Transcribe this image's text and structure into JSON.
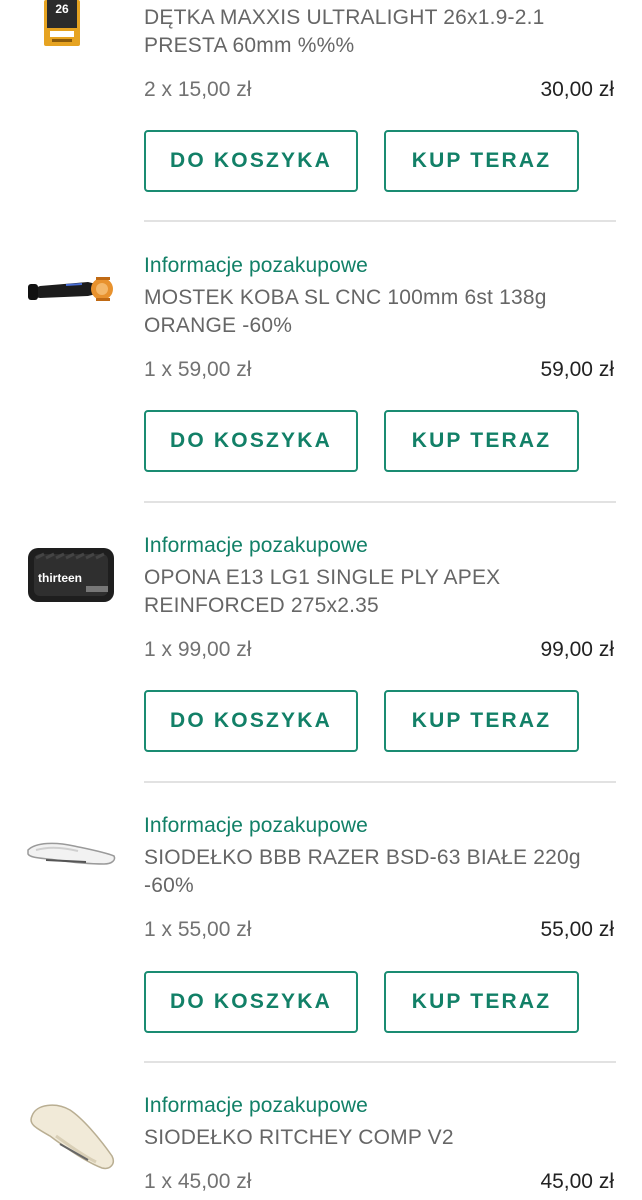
{
  "items": [
    {
      "after_purchase_link": "",
      "title": "DĘTKA MAXXIS ULTRALIGHT 26x1.9-2.1 PRESTA 60mm %%%",
      "qty_price": "2 x 15,00 zł",
      "total": "30,00 zł",
      "image_icon": "inner-tube-package-icon",
      "add_to_cart_label": "DO KOSZYKA",
      "buy_now_label": "KUP TERAZ"
    },
    {
      "after_purchase_link": "Informacje pozakupowe",
      "title": "MOSTEK KOBA SL CNC 100mm 6st 138g ORANGE -60%",
      "qty_price": "1 x 59,00 zł",
      "total": "59,00 zł",
      "image_icon": "bike-stem-icon",
      "add_to_cart_label": "DO KOSZYKA",
      "buy_now_label": "KUP TERAZ"
    },
    {
      "after_purchase_link": "Informacje pozakupowe",
      "title": "OPONA E13 LG1 SINGLE PLY APEX REINFORCED 275x2.35",
      "qty_price": "1 x 99,00 zł",
      "total": "99,00 zł",
      "image_icon": "tire-icon",
      "add_to_cart_label": "DO KOSZYKA",
      "buy_now_label": "KUP TERAZ"
    },
    {
      "after_purchase_link": "Informacje pozakupowe",
      "title": "SIODEŁKO BBB RAZER BSD-63 BIAŁE 220g -60%",
      "qty_price": "1 x 55,00 zł",
      "total": "55,00 zł",
      "image_icon": "white-saddle-icon",
      "add_to_cart_label": "DO KOSZYKA",
      "buy_now_label": "KUP TERAZ"
    },
    {
      "after_purchase_link": "Informacje pozakupowe",
      "title": "SIODEŁKO RITCHEY COMP V2",
      "qty_price": "1 x 45,00 zł",
      "total": "45,00 zł",
      "image_icon": "cream-saddle-icon"
    }
  ],
  "colors": {
    "accent": "#128067",
    "button_border": "#1a8c72",
    "divider": "#e2e2e2",
    "text_gray": "#666666",
    "text_dark": "#222222"
  }
}
